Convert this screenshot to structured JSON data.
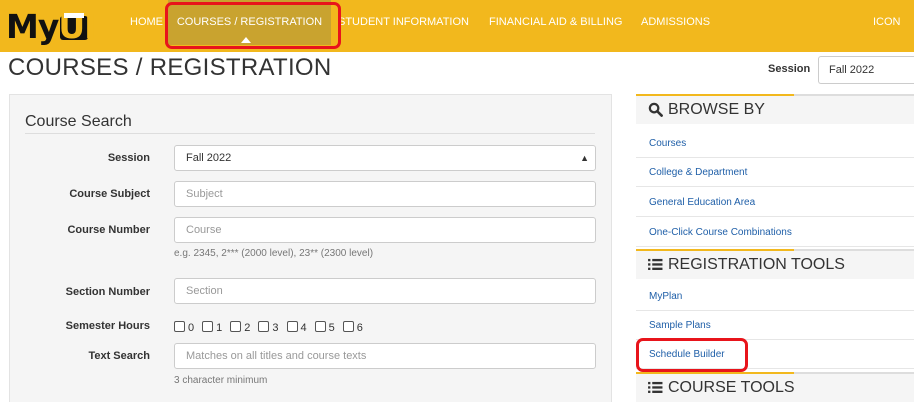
{
  "logo": {
    "my": "My",
    "ui": "UI"
  },
  "nav": {
    "home": "HOME",
    "courses": "COURSES / REGISTRATION",
    "student": "STUDENT INFORMATION",
    "finance": "FINANCIAL AID & BILLING",
    "admissions": "ADMISSIONS",
    "icons": "ICON"
  },
  "page": {
    "title": "COURSES / REGISTRATION",
    "session_label": "Session",
    "session_value": "Fall 2022"
  },
  "search": {
    "title": "Course Search",
    "session": {
      "label": "Session",
      "value": "Fall 2022"
    },
    "subject": {
      "label": "Course Subject",
      "placeholder": "Subject"
    },
    "number": {
      "label": "Course Number",
      "placeholder": "Course",
      "help": "e.g. 2345, 2*** (2000 level), 23** (2300 level)"
    },
    "section": {
      "label": "Section Number",
      "placeholder": "Section"
    },
    "hours": {
      "label": "Semester Hours",
      "options": [
        "0",
        "1",
        "2",
        "3",
        "4",
        "5",
        "6"
      ]
    },
    "text": {
      "label": "Text Search",
      "placeholder": "Matches on all titles and course texts",
      "help": "3 character minimum"
    }
  },
  "browse": {
    "title": "BROWSE BY",
    "items": [
      "Courses",
      "College & Department",
      "General Education Area",
      "One-Click Course Combinations"
    ]
  },
  "registration_tools": {
    "title": "REGISTRATION TOOLS",
    "items": [
      "MyPlan",
      "Sample Plans",
      "Schedule Builder"
    ]
  },
  "course_tools": {
    "title": "COURSE TOOLS"
  },
  "colors": {
    "brand_gold": "#f2b81d",
    "link_blue": "#1f5fa8",
    "highlight_red": "#e8141b"
  }
}
